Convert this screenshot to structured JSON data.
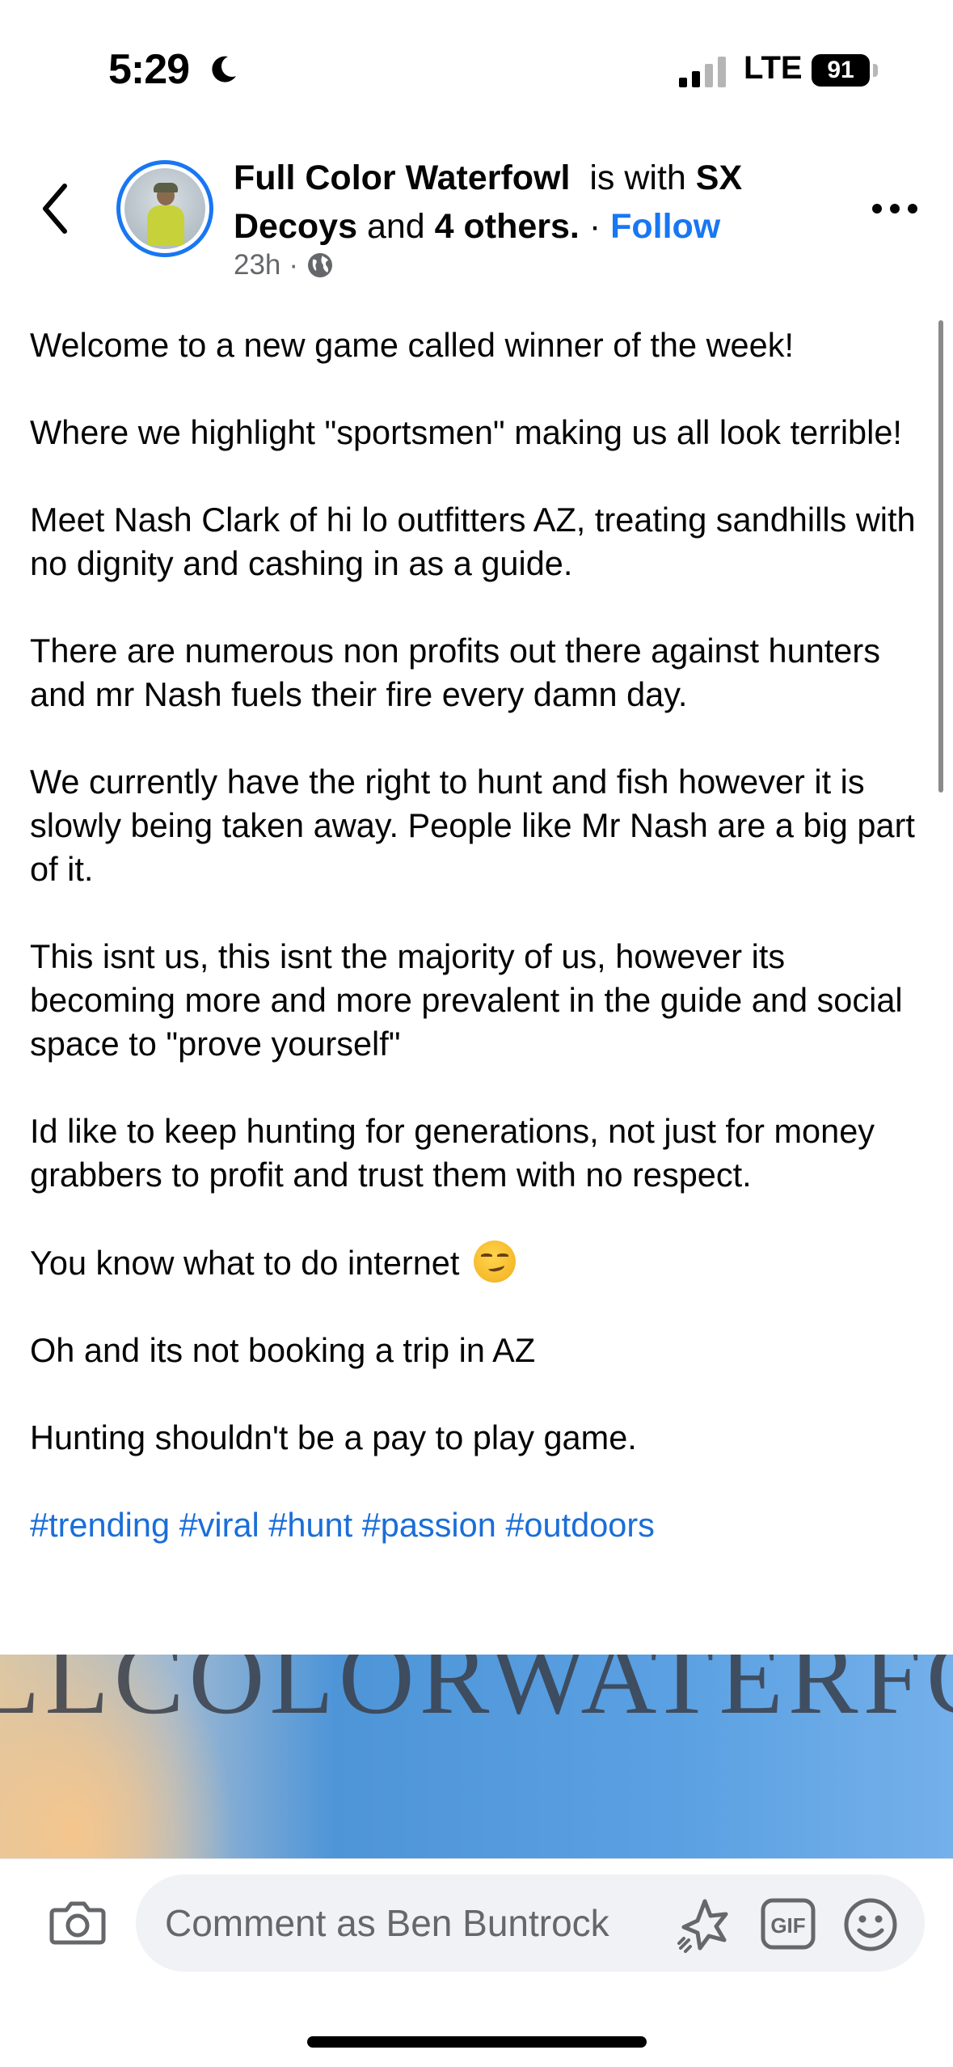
{
  "status_bar": {
    "time": "5:29",
    "network": "LTE",
    "battery": "91"
  },
  "post": {
    "author": "Full Color Waterfowl",
    "with_prefix": "is with",
    "tagged_page": "SX Decoys",
    "and_text": "and",
    "others": "4 others.",
    "separator": "·",
    "follow_label": "Follow",
    "time_ago": "23h",
    "meta_separator": "·",
    "paragraphs": [
      "Welcome to a new game called winner of the week!",
      "Where we highlight \"sportsmen\" making us all look terrible!",
      "Meet Nash Clark of hi lo outfitters AZ, treating sandhills with no dignity and cashing in as a guide.",
      "There are numerous non profits out there against hunters and mr Nash fuels their fire every damn day.",
      "We currently have the right to hunt and fish however it is slowly being taken away. People like Mr Nash are a big part of it.",
      "This isnt us, this isnt the majority of us, however its becoming more and more prevalent in the guide and social space to \"prove yourself\"",
      "Id like to keep hunting for generations, not just for money grabbers to profit and trust them with no respect.",
      "You know what to do internet",
      "Oh and its not booking a trip in AZ",
      "Hunting shouldn't be a pay to play game."
    ],
    "hashtags": [
      "#trending",
      "#viral",
      "#hunt",
      "#passion",
      "#outdoors"
    ],
    "image_watermark": "LLCOLORWATERFO"
  },
  "comment_bar": {
    "placeholder": "Comment as Ben Buntrock",
    "gif_label": "GIF"
  },
  "icons": {
    "back": "chevron-left-icon",
    "more": "more-horizontal-icon",
    "privacy": "globe-icon",
    "camera": "camera-icon",
    "sticker": "sticker-icon",
    "gif": "gif-icon",
    "emoji": "smiley-icon",
    "reaction_emoji": "smirk-emoji"
  },
  "colors": {
    "accent": "#1877f2",
    "hashtag": "#1a6ed8",
    "secondary_text": "#65676b",
    "input_bg": "#f0f2f5"
  }
}
